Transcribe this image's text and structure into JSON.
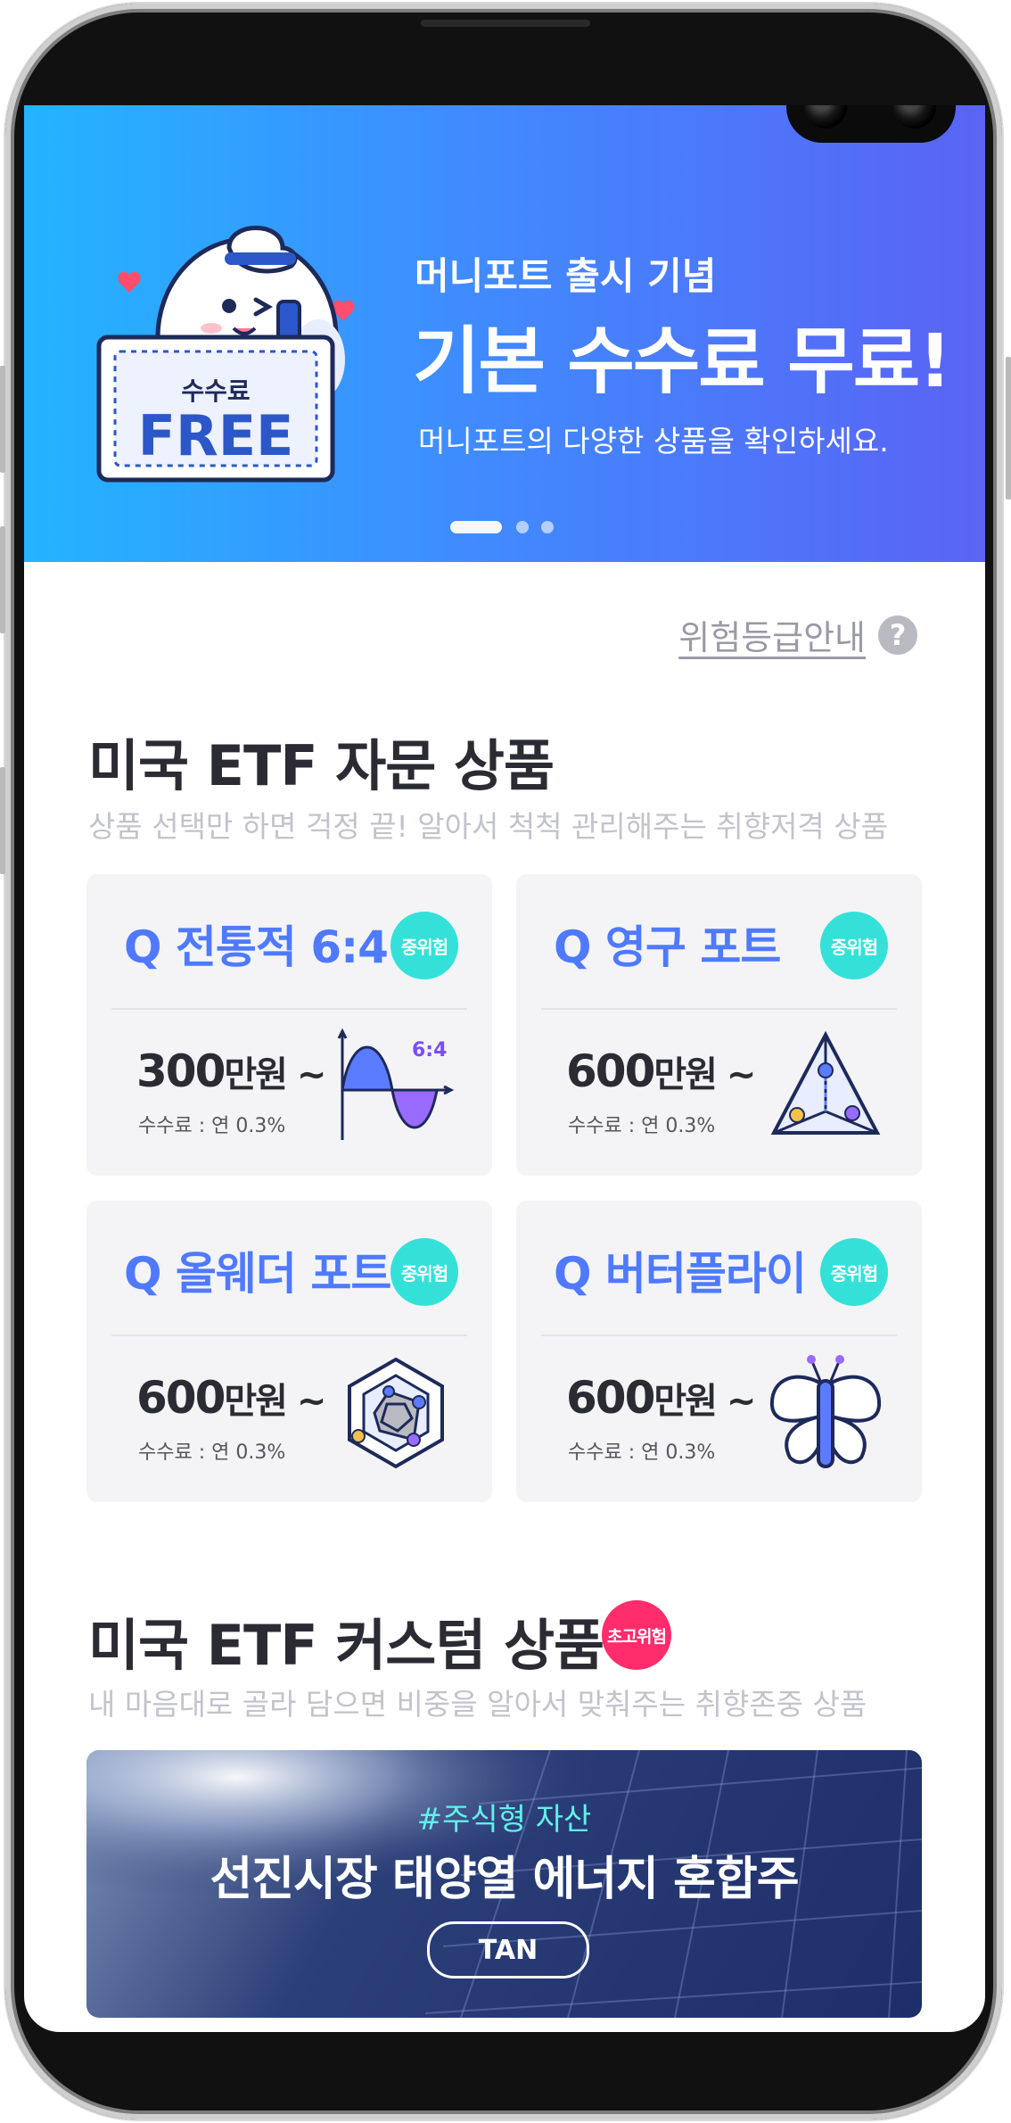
{
  "banner": {
    "subtitle": "머니포트 출시 기념",
    "title": "기본 수수료 무료!",
    "description": "머니포트의 다양한 상품을 확인하세요.",
    "mascot_ticket_label": "수수료",
    "mascot_ticket_big": "FREE",
    "page_count": 3,
    "active_page": 1
  },
  "risk_guide": {
    "label": "위험등급안내",
    "help_icon": "?"
  },
  "advisory": {
    "title": "미국 ETF 자문 상품",
    "subtitle": "상품 선택만 하면 걱정 끝! 알아서 척척 관리해주는 취향저격 상품",
    "products": [
      {
        "name": "Q 전통적 6:4",
        "badge": "중위험",
        "price": "300",
        "unit": "만원 ~",
        "fee": "수수료 : 연 0.3%",
        "icon": "wave-64-icon",
        "icon_label": "6:4"
      },
      {
        "name": "Q 영구 포트",
        "badge": "중위험",
        "price": "600",
        "unit": "만원 ~",
        "fee": "수수료 : 연 0.3%",
        "icon": "pyramid-icon"
      },
      {
        "name": "Q 올웨더 포트",
        "badge": "중위험",
        "price": "600",
        "unit": "만원 ~",
        "fee": "수수료 : 연 0.3%",
        "icon": "hexagon-radar-icon"
      },
      {
        "name": "Q 버터플라이",
        "badge": "중위험",
        "price": "600",
        "unit": "만원 ~",
        "fee": "수수료 : 연 0.3%",
        "icon": "butterfly-icon"
      }
    ]
  },
  "custom": {
    "title": "미국 ETF 커스텀 상품",
    "badge": "초고위험",
    "subtitle": "내 마음대로 골라 담으면 비중을 알아서 맞춰주는 취향존중 상품",
    "banner": {
      "tag": "#주식형 자산",
      "title": "선진시장 태양열 에너지 혼합주",
      "ticker": "TAN"
    }
  },
  "colors": {
    "accent": "#4f7aff",
    "mid_risk": "#34e1d9",
    "high_risk": "#ff2d6b",
    "banner_start": "#23b4ff",
    "banner_end": "#5a63f5"
  }
}
